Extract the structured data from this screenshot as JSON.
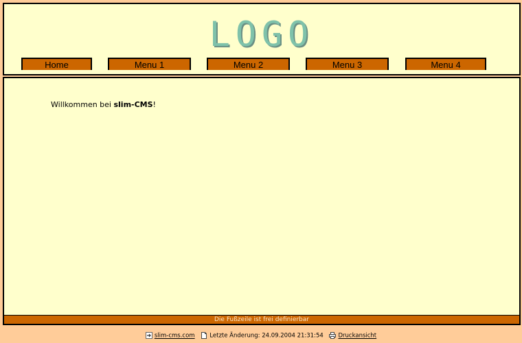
{
  "header": {
    "logo_text": "LOGO"
  },
  "nav": {
    "items": [
      {
        "label": "Home"
      },
      {
        "label": "Menu 1"
      },
      {
        "label": "Menu 2"
      },
      {
        "label": "Menu 3"
      },
      {
        "label": "Menu 4"
      }
    ]
  },
  "main": {
    "welcome_prefix": "Willkommen bei ",
    "welcome_brand": "slim-CMS",
    "welcome_suffix": "!"
  },
  "footer": {
    "text": "Die Fußzeile ist frei definierbar"
  },
  "bottom_bar": {
    "site_link": "slim-cms.com",
    "last_change": "Letzte Änderung: 24.09.2004 21:31:54",
    "print_link": "Druckansicht"
  },
  "colors": {
    "page_background": "#ffcc99",
    "panel_background": "#ffffcc",
    "accent": "#cc6600",
    "logo": "#7fc2aa"
  },
  "icons": {
    "site_link": "arrow-icon",
    "last_change": "page-icon",
    "print": "printer-icon"
  }
}
